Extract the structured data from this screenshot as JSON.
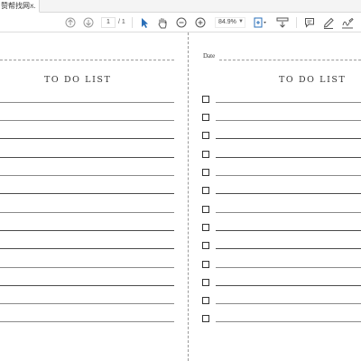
{
  "tab": {
    "title": "赞帮找网...",
    "close": "×"
  },
  "toolbar": {
    "page_current": "1",
    "page_total": "/ 1",
    "zoom": "84.9%",
    "icons": [
      "prev-page-icon",
      "next-page-icon",
      "select-cursor-icon",
      "hand-tool-icon",
      "zoom-out-icon",
      "zoom-in-icon",
      "fit-page-icon",
      "download-icon",
      "comment-icon",
      "pen-icon",
      "sign-icon"
    ],
    "accent_color": "#2a6fb8"
  },
  "document": {
    "left_page": {
      "title": "TO DO LIST",
      "line_count": 12
    },
    "right_page": {
      "date_label": "Date",
      "title": "TO DO LIST",
      "item_count": 13
    }
  }
}
